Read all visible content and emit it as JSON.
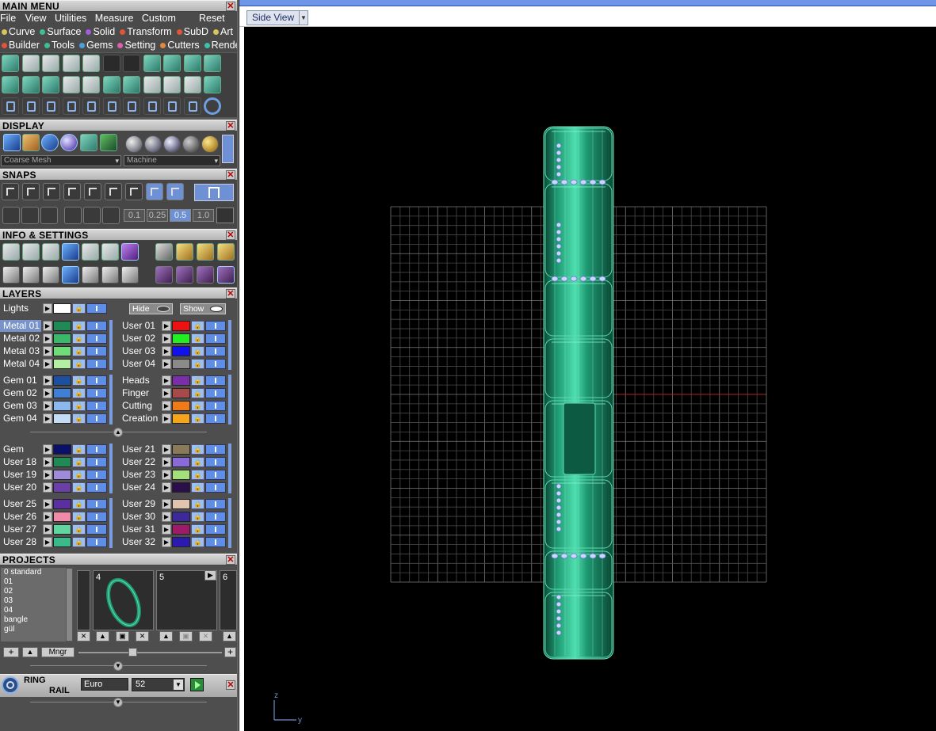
{
  "main_menu": {
    "title": "MAIN MENU",
    "top_items": [
      "File",
      "View",
      "Utilities",
      "Measure",
      "Custom"
    ],
    "reset_label": "Reset",
    "row2": [
      {
        "label": "Curve",
        "color": "#d7c45a"
      },
      {
        "label": "Surface",
        "color": "#3fbf8f"
      },
      {
        "label": "Solid",
        "color": "#a05ed8"
      },
      {
        "label": "Transform",
        "color": "#e0553a"
      },
      {
        "label": "SubD",
        "color": "#e0553a"
      },
      {
        "label": "Art",
        "color": "#d7c45a"
      }
    ],
    "row3": [
      {
        "label": "Builder",
        "color": "#e0553a"
      },
      {
        "label": "Tools",
        "color": "#3fbf8f"
      },
      {
        "label": "Gems",
        "color": "#4aa0d8"
      },
      {
        "label": "Setting",
        "color": "#d860b0"
      },
      {
        "label": "Cutters",
        "color": "#e08a3a"
      },
      {
        "label": "Render",
        "color": "#3fbfaf"
      }
    ]
  },
  "display": {
    "title": "DISPLAY",
    "mode_select": "Coarse Mesh",
    "material_select": "Machine"
  },
  "snaps": {
    "title": "SNAPS",
    "values": [
      "0.1",
      "0.25",
      "0.5",
      "1.0"
    ],
    "active_value": "0.5"
  },
  "info": {
    "title": "INFO & SETTINGS"
  },
  "layers": {
    "title": "LAYERS",
    "lights_label": "Lights",
    "hide_label": "Hide",
    "show_label": "Show",
    "left_groups": [
      [
        {
          "name": "Metal 01",
          "color": "#1f8a55"
        },
        {
          "name": "Metal 02",
          "color": "#3ab96a"
        },
        {
          "name": "Metal 03",
          "color": "#6fdc79"
        },
        {
          "name": "Metal 04",
          "color": "#b4f0a4"
        }
      ],
      [
        {
          "name": "Gem 01",
          "color": "#1c4fa0"
        },
        {
          "name": "Gem 02",
          "color": "#3f7fd6"
        },
        {
          "name": "Gem 03",
          "color": "#8cb8f0"
        },
        {
          "name": "Gem 04",
          "color": "#c5dcf6"
        }
      ],
      [
        {
          "name": "Gem",
          "color": "#0a0f6a"
        },
        {
          "name": "User 18",
          "color": "#1f8a55"
        },
        {
          "name": "User 19",
          "color": "#a08bd8"
        },
        {
          "name": "User 20",
          "color": "#6b3fa8"
        }
      ],
      [
        {
          "name": "User 25",
          "color": "#5b2fa0"
        },
        {
          "name": "User 26",
          "color": "#f08aa8"
        },
        {
          "name": "User 27",
          "color": "#5fd6a0"
        },
        {
          "name": "User 28",
          "color": "#3ab98a"
        }
      ]
    ],
    "right_groups": [
      [
        {
          "name": "User 01",
          "color": "#ee1111"
        },
        {
          "name": "User 02",
          "color": "#22ee22"
        },
        {
          "name": "User 03",
          "color": "#1111ee"
        },
        {
          "name": "User 04",
          "color": "#8a8a8a"
        }
      ],
      [
        {
          "name": "Heads",
          "color": "#7a2fa8"
        },
        {
          "name": "Finger",
          "color": "#a84a4a"
        },
        {
          "name": "Cutting",
          "color": "#ee7a1a"
        },
        {
          "name": "Creation",
          "color": "#f4a51a"
        }
      ],
      [
        {
          "name": "User 21",
          "color": "#8a7a5a"
        },
        {
          "name": "User 22",
          "color": "#8a6ad8"
        },
        {
          "name": "User 23",
          "color": "#a4e07a"
        },
        {
          "name": "User 24",
          "color": "#2a0f4a"
        }
      ],
      [
        {
          "name": "User 29",
          "color": "#e0c4b0"
        },
        {
          "name": "User 30",
          "color": "#3a2a9a"
        },
        {
          "name": "User 31",
          "color": "#a01a6a"
        },
        {
          "name": "User 32",
          "color": "#2a1ab0"
        }
      ]
    ]
  },
  "projects": {
    "title": "PROJECTS",
    "list": [
      "0 standard",
      "01",
      "02",
      "03",
      "04",
      "bangle",
      "gül"
    ],
    "slots": [
      "4",
      "5",
      "6"
    ],
    "mngr_label": "Mngr"
  },
  "ring_rail": {
    "label_line1": "RING",
    "label_line2": "RAIL",
    "standard": "Euro",
    "size": "52"
  },
  "viewport": {
    "view_label": "Side View",
    "axis_z": "z",
    "axis_y": "y",
    "model_color": "#1f9a72"
  }
}
